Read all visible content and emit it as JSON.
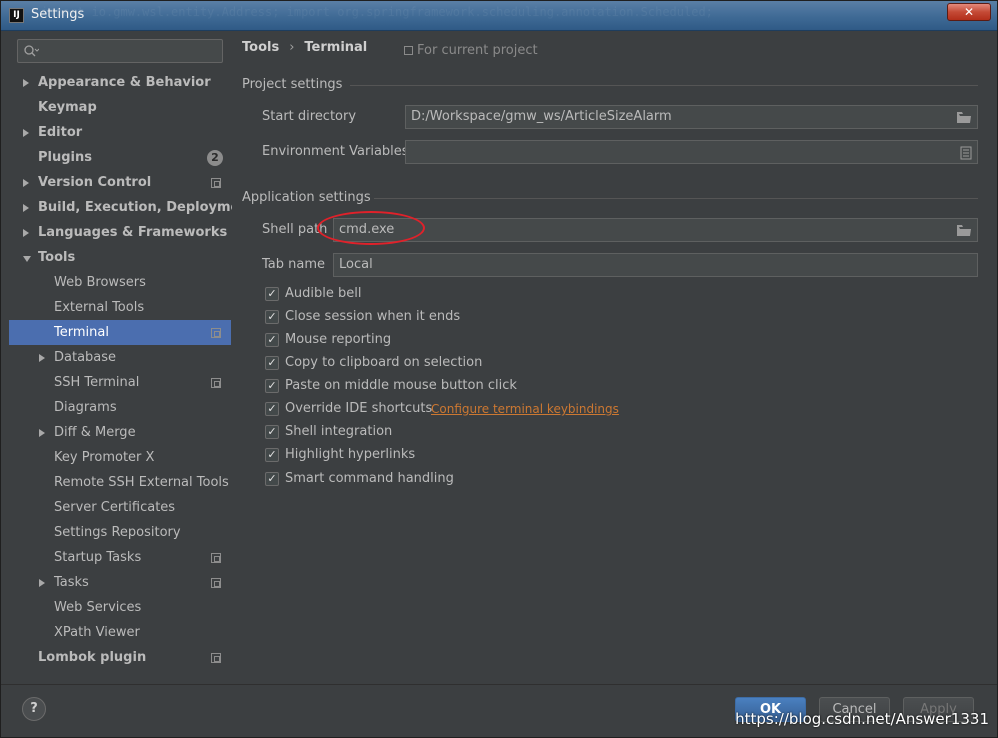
{
  "window": {
    "title": "Settings",
    "app_icon": "IJ",
    "close_label": "✕",
    "background_code": "import io.gmw.wsl.entity.Address; import org.springframework.scheduling.annotation.Scheduled;"
  },
  "sidebar": {
    "search_placeholder": "",
    "items": [
      {
        "label": "Appearance & Behavior",
        "bold": true,
        "arrow": "right",
        "indent": 0
      },
      {
        "label": "Keymap",
        "bold": true,
        "arrow": "",
        "indent": 0
      },
      {
        "label": "Editor",
        "bold": true,
        "arrow": "right",
        "indent": 0
      },
      {
        "label": "Plugins",
        "bold": true,
        "arrow": "",
        "indent": 0,
        "badge": "2"
      },
      {
        "label": "Version Control",
        "bold": true,
        "arrow": "right",
        "indent": 0,
        "project": true
      },
      {
        "label": "Build, Execution, Deployment",
        "bold": true,
        "arrow": "right",
        "indent": 0
      },
      {
        "label": "Languages & Frameworks",
        "bold": true,
        "arrow": "right",
        "indent": 0
      },
      {
        "label": "Tools",
        "bold": true,
        "arrow": "down",
        "indent": 0
      },
      {
        "label": "Web Browsers",
        "bold": false,
        "arrow": "",
        "indent": 1
      },
      {
        "label": "External Tools",
        "bold": false,
        "arrow": "",
        "indent": 1
      },
      {
        "label": "Terminal",
        "bold": false,
        "arrow": "",
        "indent": 1,
        "selected": true,
        "project": true
      },
      {
        "label": "Database",
        "bold": false,
        "arrow": "right",
        "indent": 1
      },
      {
        "label": "SSH Terminal",
        "bold": false,
        "arrow": "",
        "indent": 1,
        "project": true
      },
      {
        "label": "Diagrams",
        "bold": false,
        "arrow": "",
        "indent": 1
      },
      {
        "label": "Diff & Merge",
        "bold": false,
        "arrow": "right",
        "indent": 1
      },
      {
        "label": "Key Promoter X",
        "bold": false,
        "arrow": "",
        "indent": 1
      },
      {
        "label": "Remote SSH External Tools",
        "bold": false,
        "arrow": "",
        "indent": 1
      },
      {
        "label": "Server Certificates",
        "bold": false,
        "arrow": "",
        "indent": 1
      },
      {
        "label": "Settings Repository",
        "bold": false,
        "arrow": "",
        "indent": 1
      },
      {
        "label": "Startup Tasks",
        "bold": false,
        "arrow": "",
        "indent": 1,
        "project": true
      },
      {
        "label": "Tasks",
        "bold": false,
        "arrow": "right",
        "indent": 1,
        "project": true
      },
      {
        "label": "Web Services",
        "bold": false,
        "arrow": "",
        "indent": 1
      },
      {
        "label": "XPath Viewer",
        "bold": false,
        "arrow": "",
        "indent": 1
      },
      {
        "label": "Lombok plugin",
        "bold": true,
        "arrow": "",
        "indent": 0,
        "project": true
      }
    ]
  },
  "header": {
    "crumb_parent": "Tools",
    "crumb_sep": "›",
    "crumb_current": "Terminal",
    "scope": "For current project"
  },
  "project_settings": {
    "title": "Project settings",
    "start_directory_label": "Start directory",
    "start_directory_value": "D:/Workspace/gmw_ws/ArticleSizeAlarm",
    "env_vars_label": "Environment Variables",
    "env_vars_value": ""
  },
  "app_settings": {
    "title": "Application settings",
    "shell_path_label": "Shell path",
    "shell_path_value": "cmd.exe",
    "tab_name_label": "Tab name",
    "tab_name_value": "Local",
    "options": [
      {
        "label": "Audible bell",
        "checked": true
      },
      {
        "label": "Close session when it ends",
        "checked": true
      },
      {
        "label": "Mouse reporting",
        "checked": true
      },
      {
        "label": "Copy to clipboard on selection",
        "checked": true
      },
      {
        "label": "Paste on middle mouse button click",
        "checked": true
      },
      {
        "label": "Override IDE shortcuts",
        "checked": true
      },
      {
        "label": "Shell integration",
        "checked": true
      },
      {
        "label": "Highlight hyperlinks",
        "checked": true
      },
      {
        "label": "Smart command handling",
        "checked": true
      }
    ],
    "keybindings_link": "Configure terminal keybindings"
  },
  "footer": {
    "help": "?",
    "ok": "OK",
    "cancel": "Cancel",
    "apply": "Apply",
    "watermark": "https://blog.csdn.net/Answer1331"
  },
  "colors": {
    "selection": "#4b6eaf",
    "link": "#cc7832",
    "highlight_ring": "#e0212a"
  }
}
